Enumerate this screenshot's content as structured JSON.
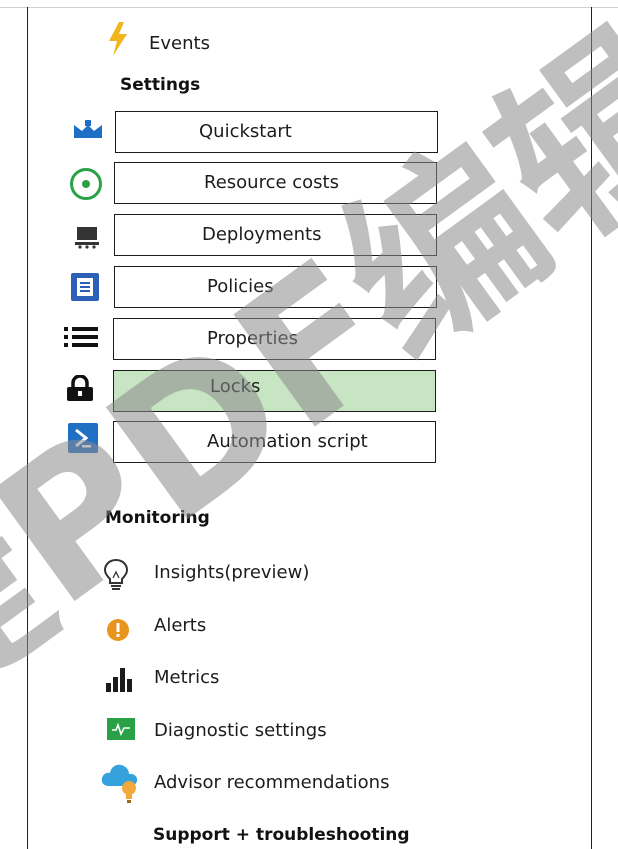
{
  "events": {
    "label": "Events",
    "icon": "lightning-icon",
    "icon_color": "#f2b61c"
  },
  "settings": {
    "heading": "Settings",
    "items": [
      {
        "label": "Quickstart",
        "icon": "quickstart-icon"
      },
      {
        "label": "Resource costs",
        "icon": "resource-costs-icon"
      },
      {
        "label": "Deployments",
        "icon": "deployments-icon"
      },
      {
        "label": "Policies",
        "icon": "policies-icon"
      },
      {
        "label": "Properties",
        "icon": "properties-list-icon"
      },
      {
        "label": "Locks",
        "icon": "lock-icon",
        "selected": true
      },
      {
        "label": "Automation script",
        "icon": "automation-script-icon"
      }
    ]
  },
  "monitoring": {
    "heading": "Monitoring",
    "items": [
      {
        "label": "Insights(preview)",
        "icon": "lightbulb-icon"
      },
      {
        "label": "Alerts",
        "icon": "alert-icon"
      },
      {
        "label": "Metrics",
        "icon": "metrics-chart-icon"
      },
      {
        "label": "Diagnostic settings",
        "icon": "diagnostic-settings-icon"
      },
      {
        "label": "Advisor recommendations",
        "icon": "advisor-cloud-icon"
      }
    ]
  },
  "support": {
    "heading": "Support + troubleshooting"
  },
  "watermark": {
    "text": "捷PDF编辑",
    "color": "#8a8a8a"
  },
  "colors": {
    "selected_bg": "#c7e4c3",
    "azure_blue": "#1f6fc5",
    "green": "#2aa146",
    "orange": "#e8951d"
  }
}
